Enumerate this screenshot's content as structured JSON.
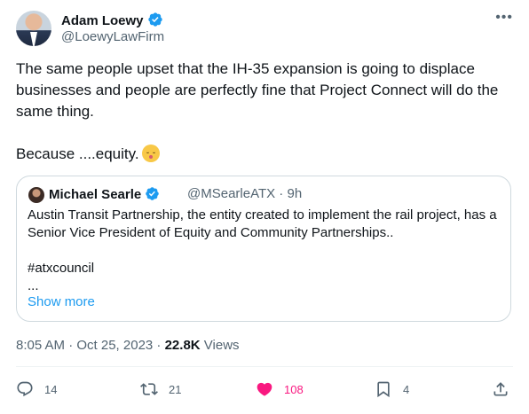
{
  "author": {
    "name": "Adam Loewy",
    "handle": "@LoewyLawFirm",
    "verified_icon": "verified-badge-icon"
  },
  "more_icon": "more-options-icon",
  "tweet": {
    "text_line1": "The same people upset that the IH-35 expansion is going to displace businesses and people are perfectly fine that Project Connect will do the same thing.",
    "text_line2": "Because ....equity.",
    "emoji": "kissing-face-with-smiling-eyes"
  },
  "quoted": {
    "name": "Michael Searle",
    "handle": "@MSearleATX · 9h",
    "text": "Austin Transit Partnership, the entity created to implement the rail project, has a Senior Vice President of Equity and Community Partnerships..\n\n#atxcouncil\n...",
    "show_more": "Show more"
  },
  "meta": {
    "time": "8:05 AM · Oct 25, 2023 · ",
    "views_count": "22.8K",
    "views_label": " Views"
  },
  "actions": {
    "replies": "14",
    "reposts": "21",
    "likes": "108",
    "bookmarks": "4"
  },
  "colors": {
    "accent": "#1d9bf0",
    "like": "#f91880",
    "secondary_text": "#536471"
  }
}
